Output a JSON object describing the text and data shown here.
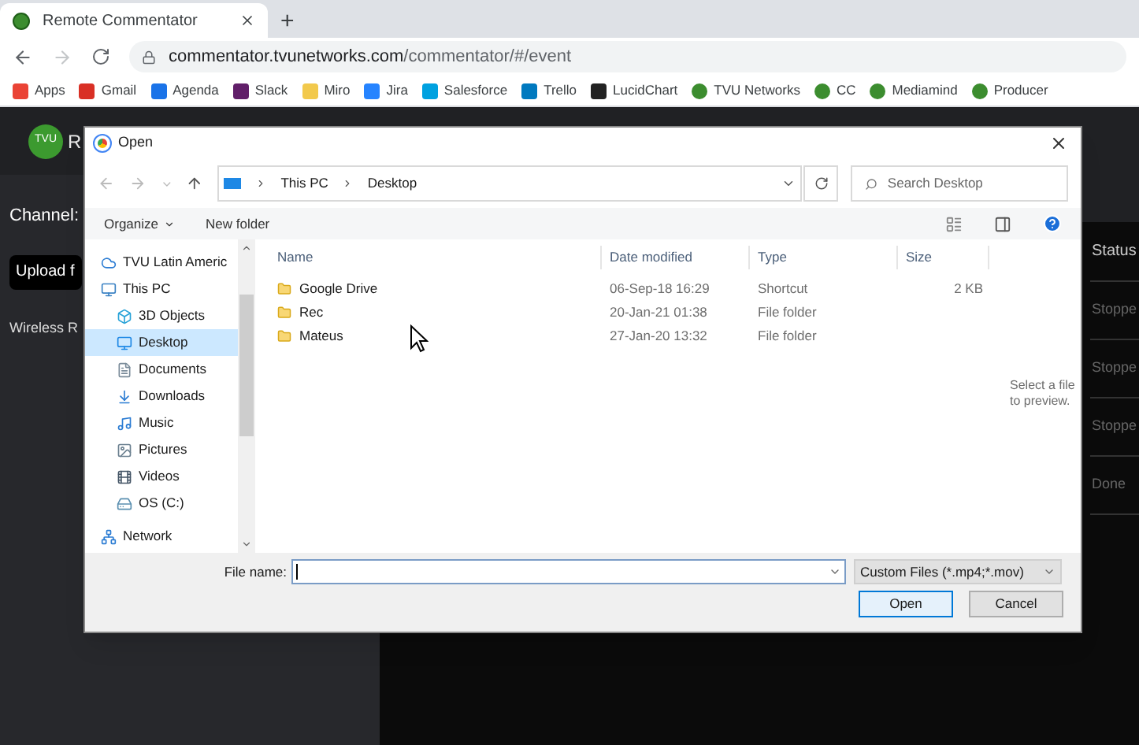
{
  "browser": {
    "tab_title": "Remote Commentator",
    "new_tab": "+",
    "url_host": "commentator.tvunetworks.com",
    "url_path": "/commentator/#/event",
    "bookmarks": [
      "Apps",
      "Gmail",
      "Agenda",
      "Slack",
      "Miro",
      "Jira",
      "Salesforce",
      "Trello",
      "LucidChart",
      "TVU Networks",
      "CC",
      "Mediamind",
      "Producer"
    ]
  },
  "app": {
    "logo": "TVU",
    "title": "R",
    "channel_label": "Channel:",
    "upload_button": "Upload f",
    "wireless_label": "Wireless R",
    "status_header": "Status",
    "status_rows": [
      "Stoppe",
      "Stoppe",
      "Stoppe",
      "Done"
    ]
  },
  "dialog": {
    "title": "Open",
    "path": [
      "This PC",
      "Desktop"
    ],
    "search": {
      "placeholder": "Search Desktop"
    },
    "organize": "Organize",
    "new_folder": "New folder",
    "nav": [
      {
        "label": "TVU Latin Americ",
        "selected": false
      },
      {
        "label": "This PC",
        "selected": false,
        "children": [
          {
            "label": "3D Objects",
            "selected": false
          },
          {
            "label": "Desktop",
            "selected": true
          },
          {
            "label": "Documents",
            "selected": false
          },
          {
            "label": "Downloads",
            "selected": false
          },
          {
            "label": "Music",
            "selected": false
          },
          {
            "label": "Pictures",
            "selected": false
          },
          {
            "label": "Videos",
            "selected": false
          },
          {
            "label": "OS (C:)",
            "selected": false
          }
        ]
      },
      {
        "label": "Network",
        "selected": false
      }
    ],
    "columns": [
      "Name",
      "Date modified",
      "Type",
      "Size"
    ],
    "files": [
      {
        "name": "Google Drive",
        "date": "06-Sep-18 16:29",
        "type": "Shortcut",
        "size": "2 KB"
      },
      {
        "name": "Rec",
        "date": "20-Jan-21 01:38",
        "type": "File folder"
      },
      {
        "name": "Mateus",
        "date": "27-Jan-20 13:32",
        "type": "File folder"
      }
    ],
    "preview": "Select a file to preview.",
    "file_name_label": "File name:",
    "filter": "Custom Files (*.mp4;*.mov)",
    "open_button": "Open",
    "cancel_button": "Cancel"
  }
}
